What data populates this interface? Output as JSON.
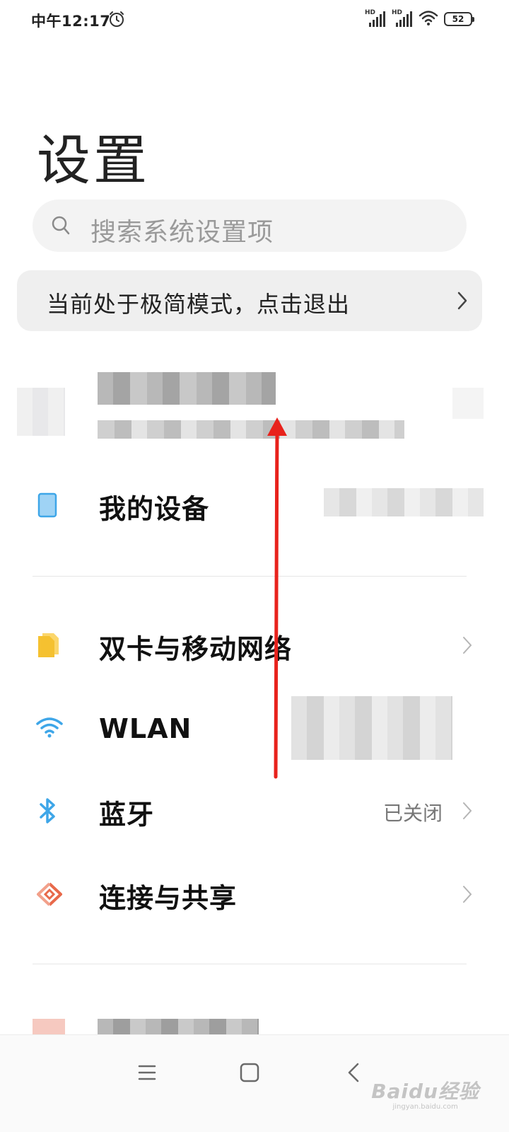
{
  "status_bar": {
    "time": "中午12:17",
    "battery": "52",
    "hd_label_1": "HD",
    "hd_label_2": "HD",
    "icons": [
      "alarm-icon",
      "hd-signal-icon",
      "hd-signal-icon",
      "wifi-icon",
      "battery-icon"
    ]
  },
  "page": {
    "title": "设置"
  },
  "search": {
    "placeholder": "搜索系统设置项",
    "icon": "search-icon"
  },
  "banner": {
    "text": "当前处于极简模式，点击退出",
    "icon": "chevron-right-icon"
  },
  "settings": {
    "my_device": {
      "label": "我的设备",
      "icon": "device-icon"
    },
    "sim": {
      "label": "双卡与移动网络",
      "icon": "sim-card-icon"
    },
    "wlan": {
      "label": "WLAN",
      "icon": "wifi-icon"
    },
    "bluetooth": {
      "label": "蓝牙",
      "value": "已关闭",
      "icon": "bluetooth-icon"
    },
    "connection": {
      "label": "连接与共享",
      "icon": "connection-share-icon"
    }
  },
  "nav": {
    "icons": [
      "menu-icon",
      "home-icon",
      "back-icon"
    ]
  },
  "watermark": {
    "logo": "Baidu经验",
    "url": "jingyan.baidu.com"
  },
  "colors": {
    "accent_blue": "#3ea6e8",
    "sim_yellow": "#f5c130",
    "share_orange": "#e8694a",
    "arrow_red": "#e8221c"
  }
}
